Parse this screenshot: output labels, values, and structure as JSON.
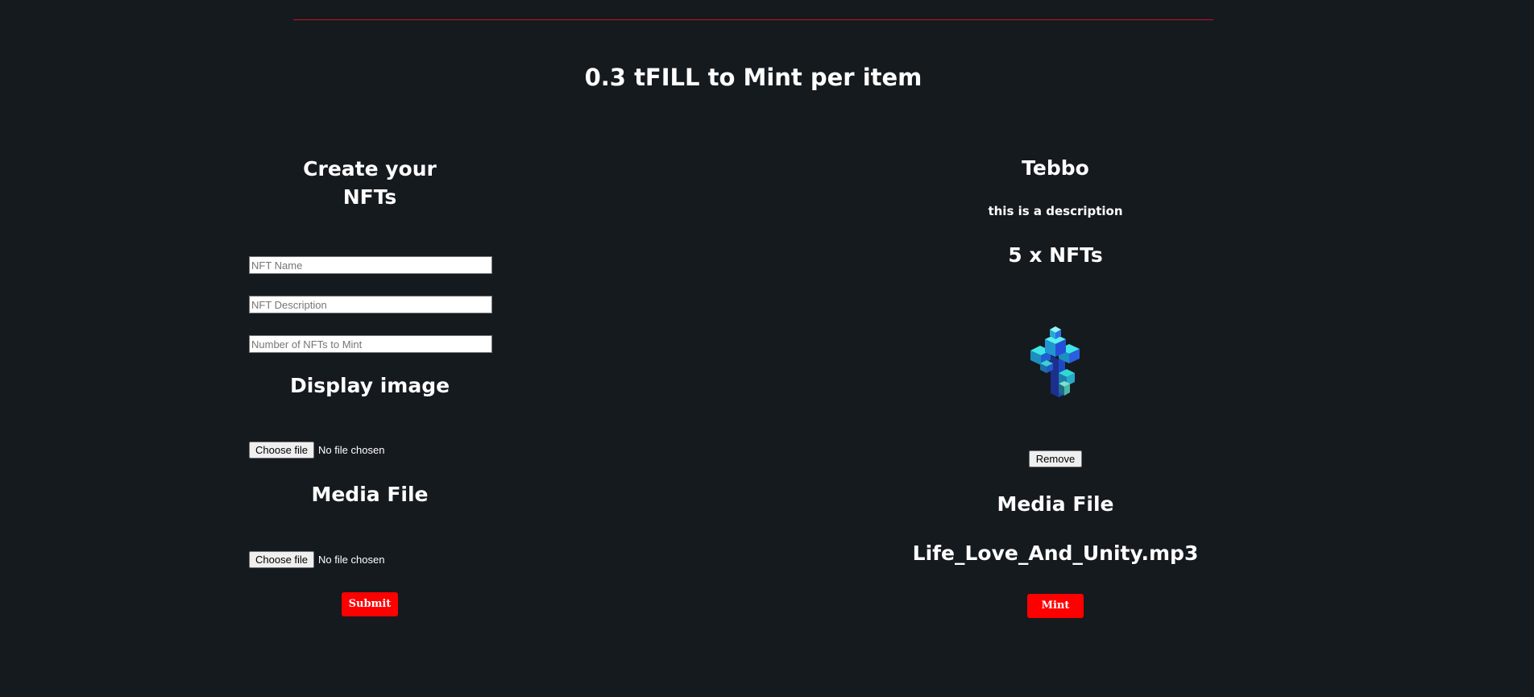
{
  "header": {
    "price_title": "0.3 tFILL to Mint per item"
  },
  "create_form": {
    "title_line1": "Create your",
    "title_line2": "NFTs",
    "name_placeholder": "NFT Name",
    "name_value": "",
    "description_placeholder": "NFT Description",
    "description_value": "",
    "quantity_placeholder": "Number of NFTs to Mint",
    "quantity_value": "",
    "display_image_heading": "Display image",
    "display_image_button": "Choose file",
    "display_image_status": "No file chosen",
    "media_file_heading": "Media File",
    "media_file_button": "Choose file",
    "media_file_status": "No file chosen",
    "submit_label": "Submit"
  },
  "preview": {
    "name": "Tebbo",
    "description": "this is a description",
    "count_text": "5 x NFTs",
    "image_icon": "cube-tree-icon",
    "remove_label": "Remove",
    "media_file_heading": "Media File",
    "media_filename": "Life_Love_And_Unity.mp3",
    "mint_label": "Mint"
  },
  "colors": {
    "background": "#151a1f",
    "accent_red": "#ff0000",
    "divider_red": "#c0161d"
  }
}
